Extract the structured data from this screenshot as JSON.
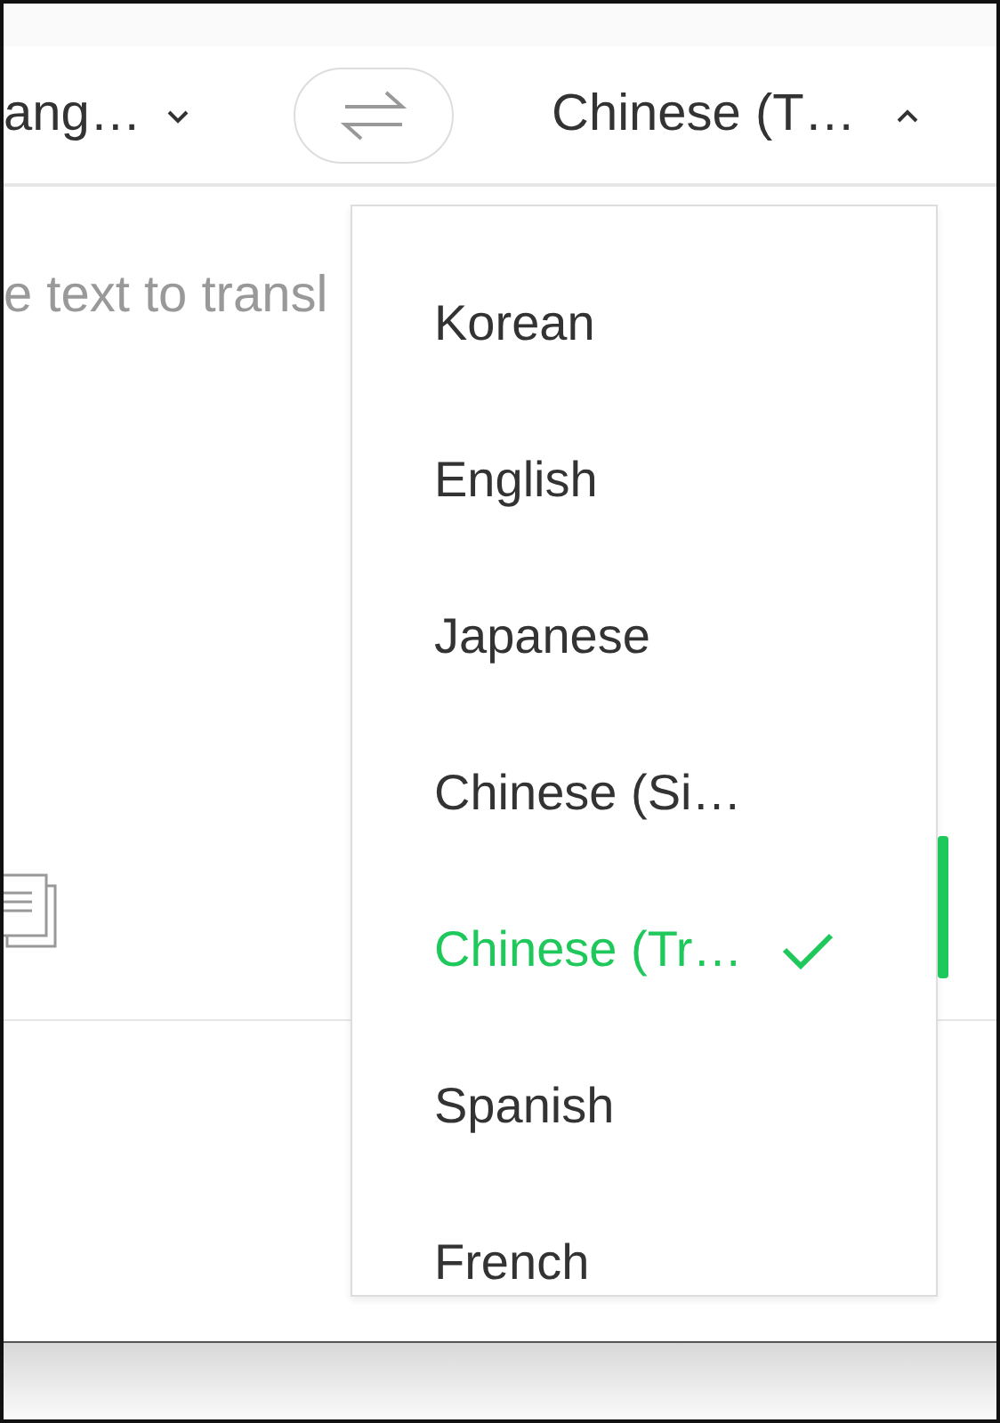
{
  "source_language": {
    "label": "ang…",
    "expanded": false
  },
  "target_language": {
    "label": "Chinese (T…",
    "expanded": true
  },
  "input": {
    "placeholder": "e text to transl"
  },
  "language_menu": {
    "items": [
      {
        "label": "Korean",
        "selected": false
      },
      {
        "label": "English",
        "selected": false
      },
      {
        "label": "Japanese",
        "selected": false
      },
      {
        "label": "Chinese (Si…",
        "selected": false
      },
      {
        "label": "Chinese (Tr…",
        "selected": true
      },
      {
        "label": "Spanish",
        "selected": false
      },
      {
        "label": "French",
        "selected": false
      }
    ]
  }
}
